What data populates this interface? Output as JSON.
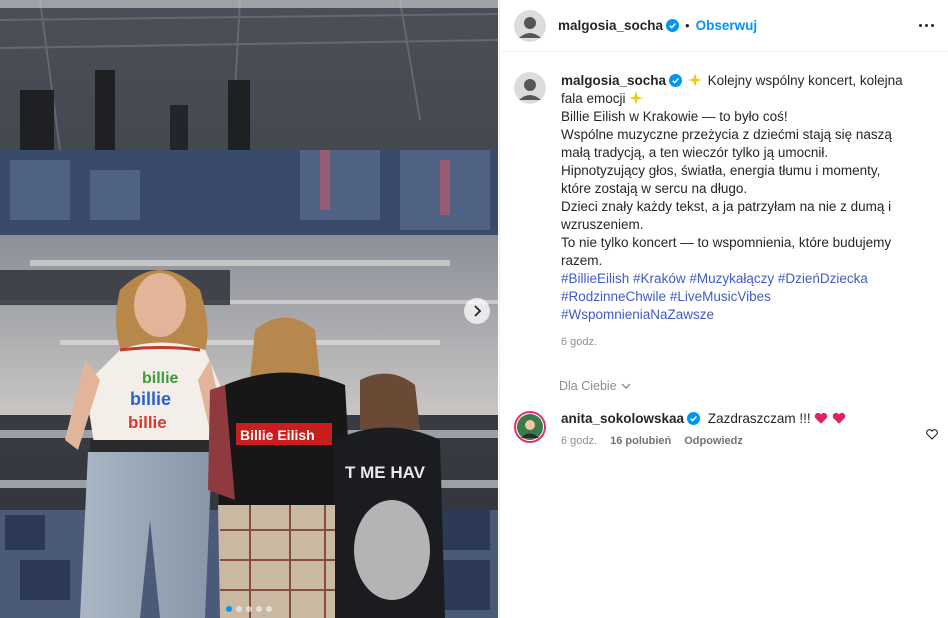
{
  "header": {
    "username": "malgosia_socha",
    "separator": "•",
    "follow_label": "Obserwuj"
  },
  "post": {
    "username": "malgosia_socha",
    "caption_lines": [
      "Kolejny wspólny koncert, kolejna fala emocji",
      "Billie Eilish w Krakowie — to było coś!",
      "Wspólne muzyczne przeżycia z dziećmi stają się naszą małą tradycją, a ten wieczór tylko ją umocnił.",
      "Hipnotyzujący głos, światła, energia tłumu i momenty, które zostają w sercu na długo.",
      "Dzieci znały każdy tekst, a ja patrzyłam na nie z dumą i wzruszeniem.",
      "To nie tylko koncert — to wspomnienia, które budujemy razem."
    ],
    "hashtags": [
      "#BillieEilish",
      "#Kraków",
      "#Muzykałączy",
      "#DzieńDziecka",
      "#RodzinneChwile",
      "#LiveMusicVibes",
      "#WspomnieniaNaZawsze"
    ],
    "time": "6 godz.",
    "sparkle_icon": "sparkles-icon"
  },
  "comments_section": {
    "for_you_label": "Dla Ciebie"
  },
  "comment": {
    "username": "anita_sokolowskaa",
    "text": "Zazdraszczam !!!",
    "time": "6 godz.",
    "likes": "16 polubień",
    "reply_label": "Odpowiedz"
  },
  "photo": {
    "shirt_text_1": "billie",
    "shirt_text_2": "billie",
    "shirt_text_3": "billie",
    "tee_text": "Billie Eilish",
    "hoodie_text": "T ME HAV",
    "carousel_count": 5,
    "carousel_active": 1
  },
  "colors": {
    "accent": "#0095f6",
    "verified": "#0095f6",
    "hashtag": "#3f5dc4",
    "heart": "#e0245e"
  }
}
